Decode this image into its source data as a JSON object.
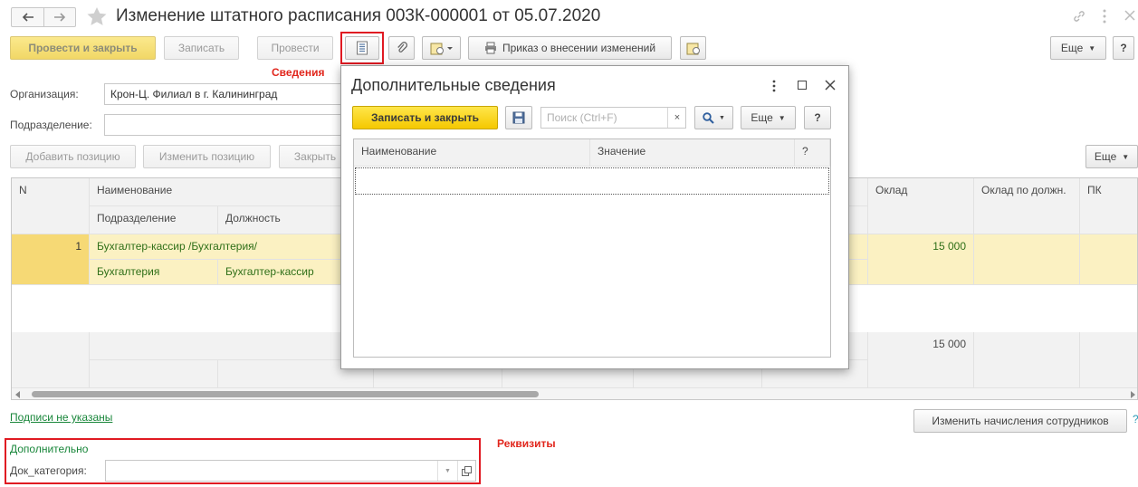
{
  "window": {
    "title": "Изменение штатного расписания 003К-000001 от 05.07.2020"
  },
  "toolbar": {
    "post_close": "Провести и закрыть",
    "save": "Записать",
    "post": "Провести",
    "print_order": "Приказ о внесении изменений",
    "more": "Еще",
    "help": "?"
  },
  "annotations": {
    "info_label": "Сведения",
    "requisites_label": "Реквизиты"
  },
  "form": {
    "org_label": "Организация:",
    "org_value": "Крон-Ц. Филиал в г. Калининград",
    "dept_label": "Подразделение:",
    "dept_value": ""
  },
  "table_toolbar": {
    "add": "Добавить позицию",
    "edit": "Изменить позицию",
    "close": "Закрыть",
    "more": "Еще"
  },
  "table": {
    "headers": {
      "n": "N",
      "name": "Наименование",
      "dept": "Подразделение",
      "position": "Должность",
      "salary": "Оклад",
      "salary_by_pos": "Оклад по должн.",
      "pk": "ПК"
    },
    "rows": [
      {
        "n": "1",
        "name": "Бухгалтер-кассир /Бухгалтерия/",
        "dept": "Бухгалтерия",
        "position": "Бухгалтер-кассир",
        "salary": "15 000"
      }
    ],
    "total_salary": "15 000"
  },
  "footer": {
    "signatures": "Подписи не указаны",
    "change_accruals": "Изменить начисления сотрудников",
    "help": "?",
    "additional": "Дополнительно",
    "doc_category_label": "Док_категория:",
    "doc_category_value": ""
  },
  "dialog": {
    "title": "Дополнительные сведения",
    "save_close": "Записать и закрыть",
    "search_placeholder": "Поиск (Ctrl+F)",
    "more": "Еще",
    "help": "?",
    "columns": {
      "name": "Наименование",
      "value": "Значение",
      "q": "?"
    }
  },
  "colors": {
    "accent_yellow": "#f5c800",
    "highlight_red": "#e01a22",
    "link_green": "#18863a",
    "selected_row": "#fbf1c2"
  }
}
